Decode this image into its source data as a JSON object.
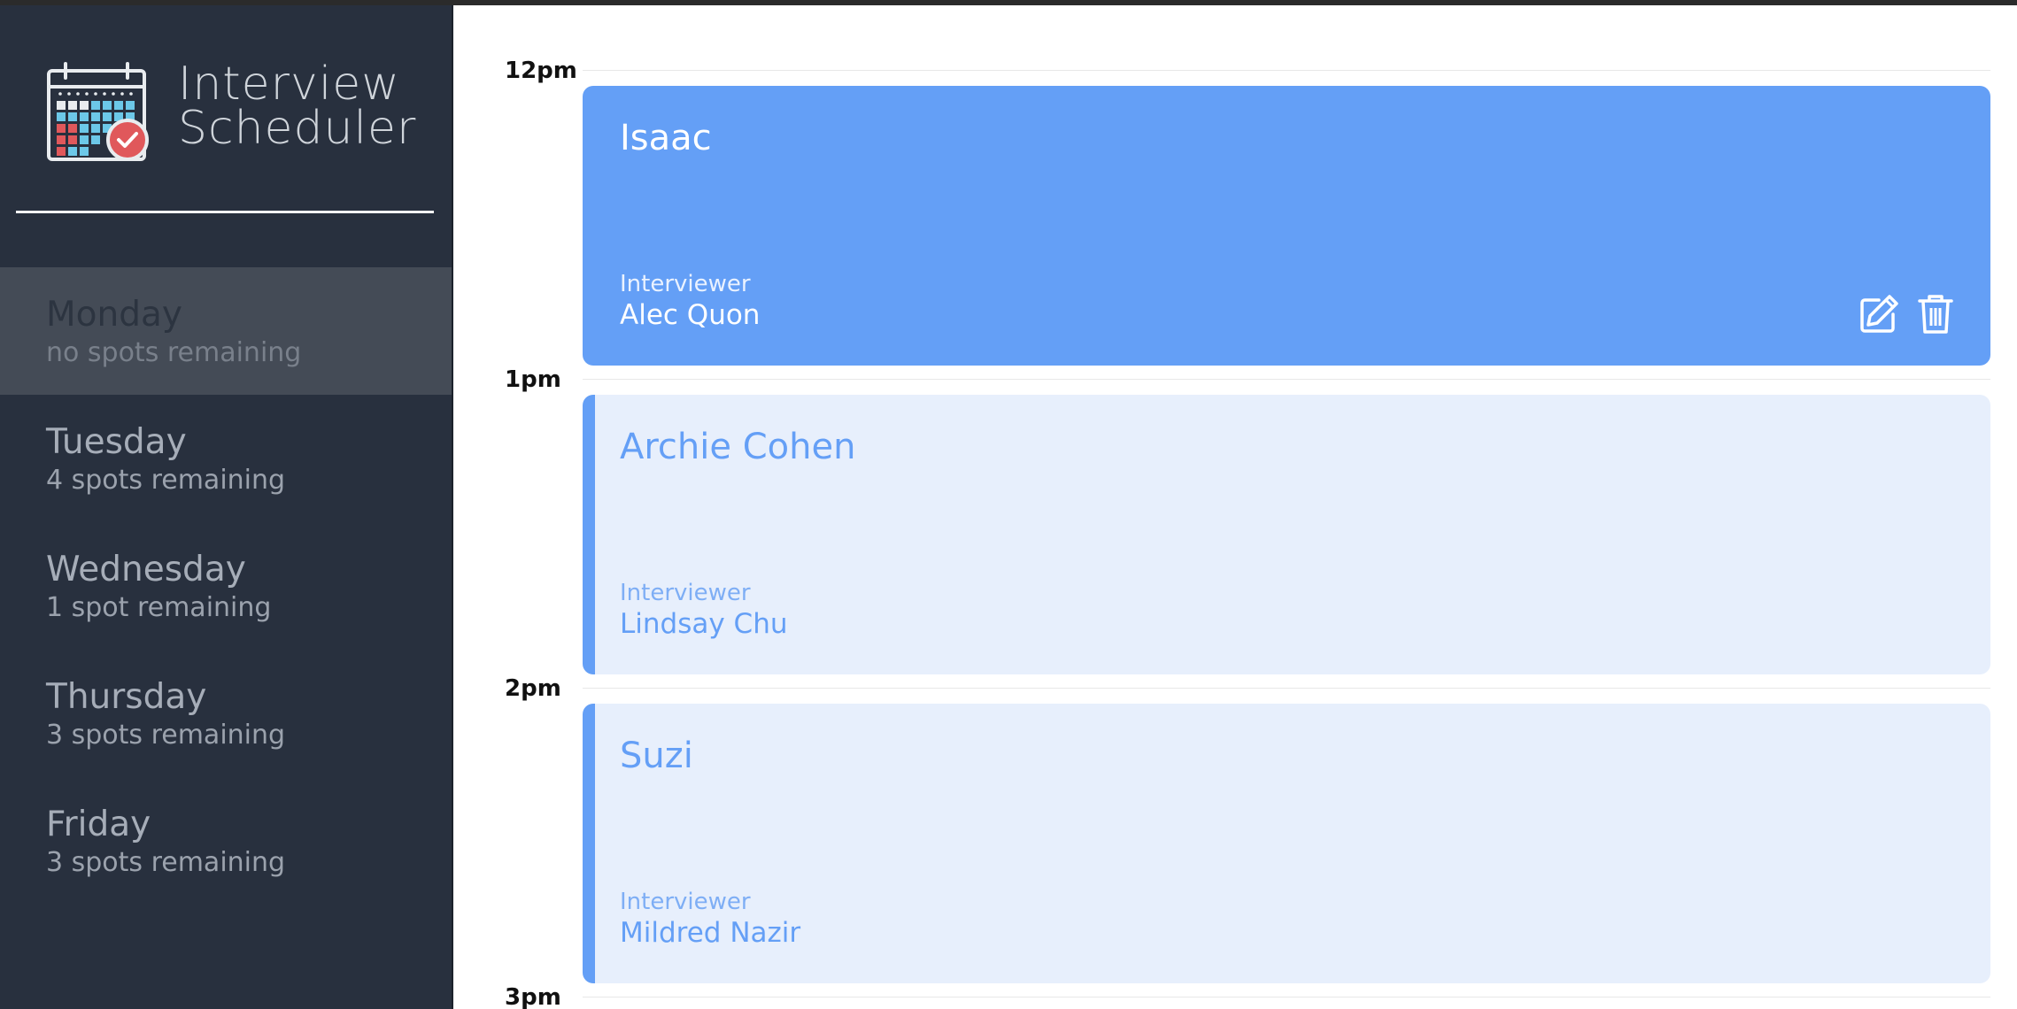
{
  "brand": {
    "line1": "Interview",
    "line2": "Scheduler",
    "logo_icon": "calendar-check-icon"
  },
  "colors": {
    "sidebar_bg": "#28303e",
    "selected_day_bg": "#444b56",
    "accent_blue": "#649ff6",
    "booked_bg": "#e7effc"
  },
  "days": [
    {
      "name": "Monday",
      "spots": "no spots remaining",
      "selected": true
    },
    {
      "name": "Tuesday",
      "spots": "4 spots remaining",
      "selected": false
    },
    {
      "name": "Wednesday",
      "spots": "1 spot remaining",
      "selected": false
    },
    {
      "name": "Thursday",
      "spots": "3 spots remaining",
      "selected": false
    },
    {
      "name": "Friday",
      "spots": "3 spots remaining",
      "selected": false
    }
  ],
  "schedule": {
    "times": [
      "12pm",
      "1pm",
      "2pm",
      "3pm"
    ],
    "appointments": [
      {
        "student": "Isaac",
        "interviewer_label": "Interviewer",
        "interviewer": "Alec Quon",
        "state": "active",
        "actions": [
          "edit-icon",
          "trash-icon"
        ]
      },
      {
        "student": "Archie Cohen",
        "interviewer_label": "Interviewer",
        "interviewer": "Lindsay Chu",
        "state": "booked"
      },
      {
        "student": "Suzi",
        "interviewer_label": "Interviewer",
        "interviewer": "Mildred Nazir",
        "state": "booked"
      }
    ]
  }
}
